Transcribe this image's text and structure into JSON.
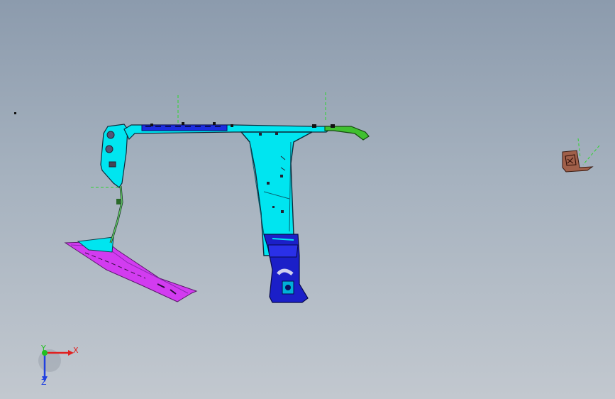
{
  "viewport": {
    "background_top": "#8c9bad",
    "background_bottom": "#c2c8cf"
  },
  "model": {
    "parts": [
      {
        "name": "a-pillar-trim",
        "color": "#00e5f0"
      },
      {
        "name": "roof-rail-trim",
        "color": "#1c2de0"
      },
      {
        "name": "b-pillar-trim",
        "color": "#00e5f0"
      },
      {
        "name": "b-pillar-lower",
        "color": "#1b1fc8"
      },
      {
        "name": "door-sill-trim",
        "color": "#d23cf0"
      },
      {
        "name": "rear-rail-end",
        "color": "#40c030"
      },
      {
        "name": "small-bracket",
        "color": "#a0604a"
      }
    ],
    "reference_line_color": "#2ed62e"
  },
  "triad": {
    "x_label": "X",
    "y_label": "Y",
    "z_label": "Z",
    "x_color": "#e02020",
    "y_color": "#20c020",
    "z_color": "#2040e0"
  }
}
